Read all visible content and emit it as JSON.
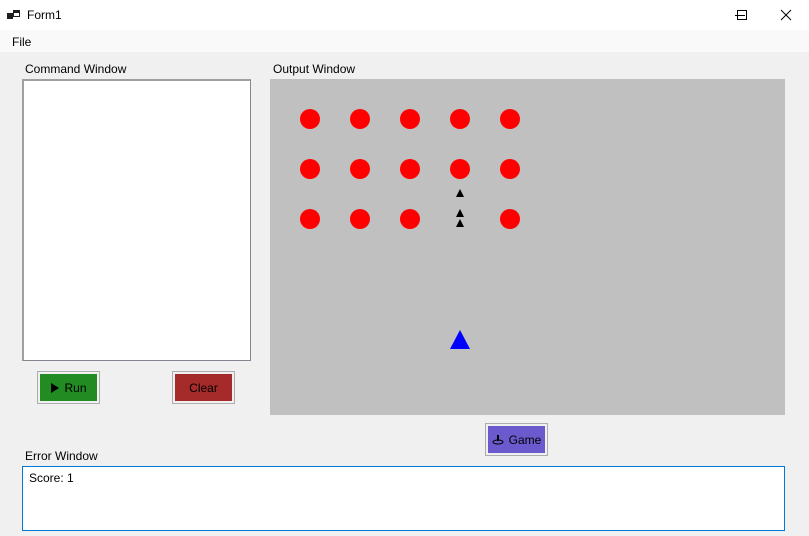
{
  "window": {
    "title": "Form1"
  },
  "menu": {
    "items": [
      {
        "label": "File"
      }
    ]
  },
  "command_window": {
    "label": "Command Window",
    "text": ""
  },
  "output_window": {
    "label": "Output Window",
    "background": "#c0c0c0",
    "enemy_color": "#ff0000",
    "player_color": "#0000ff",
    "bullet_color": "#000000"
  },
  "buttons": {
    "run": {
      "label": "Run",
      "icon": "play-icon",
      "color": "#228b22"
    },
    "clear": {
      "label": "Clear",
      "color": "#a52a2a"
    },
    "game": {
      "label": "Game",
      "icon": "ship-icon",
      "color": "#6a5acd"
    }
  },
  "error_window": {
    "label": "Error Window",
    "text": "Score: 1"
  }
}
